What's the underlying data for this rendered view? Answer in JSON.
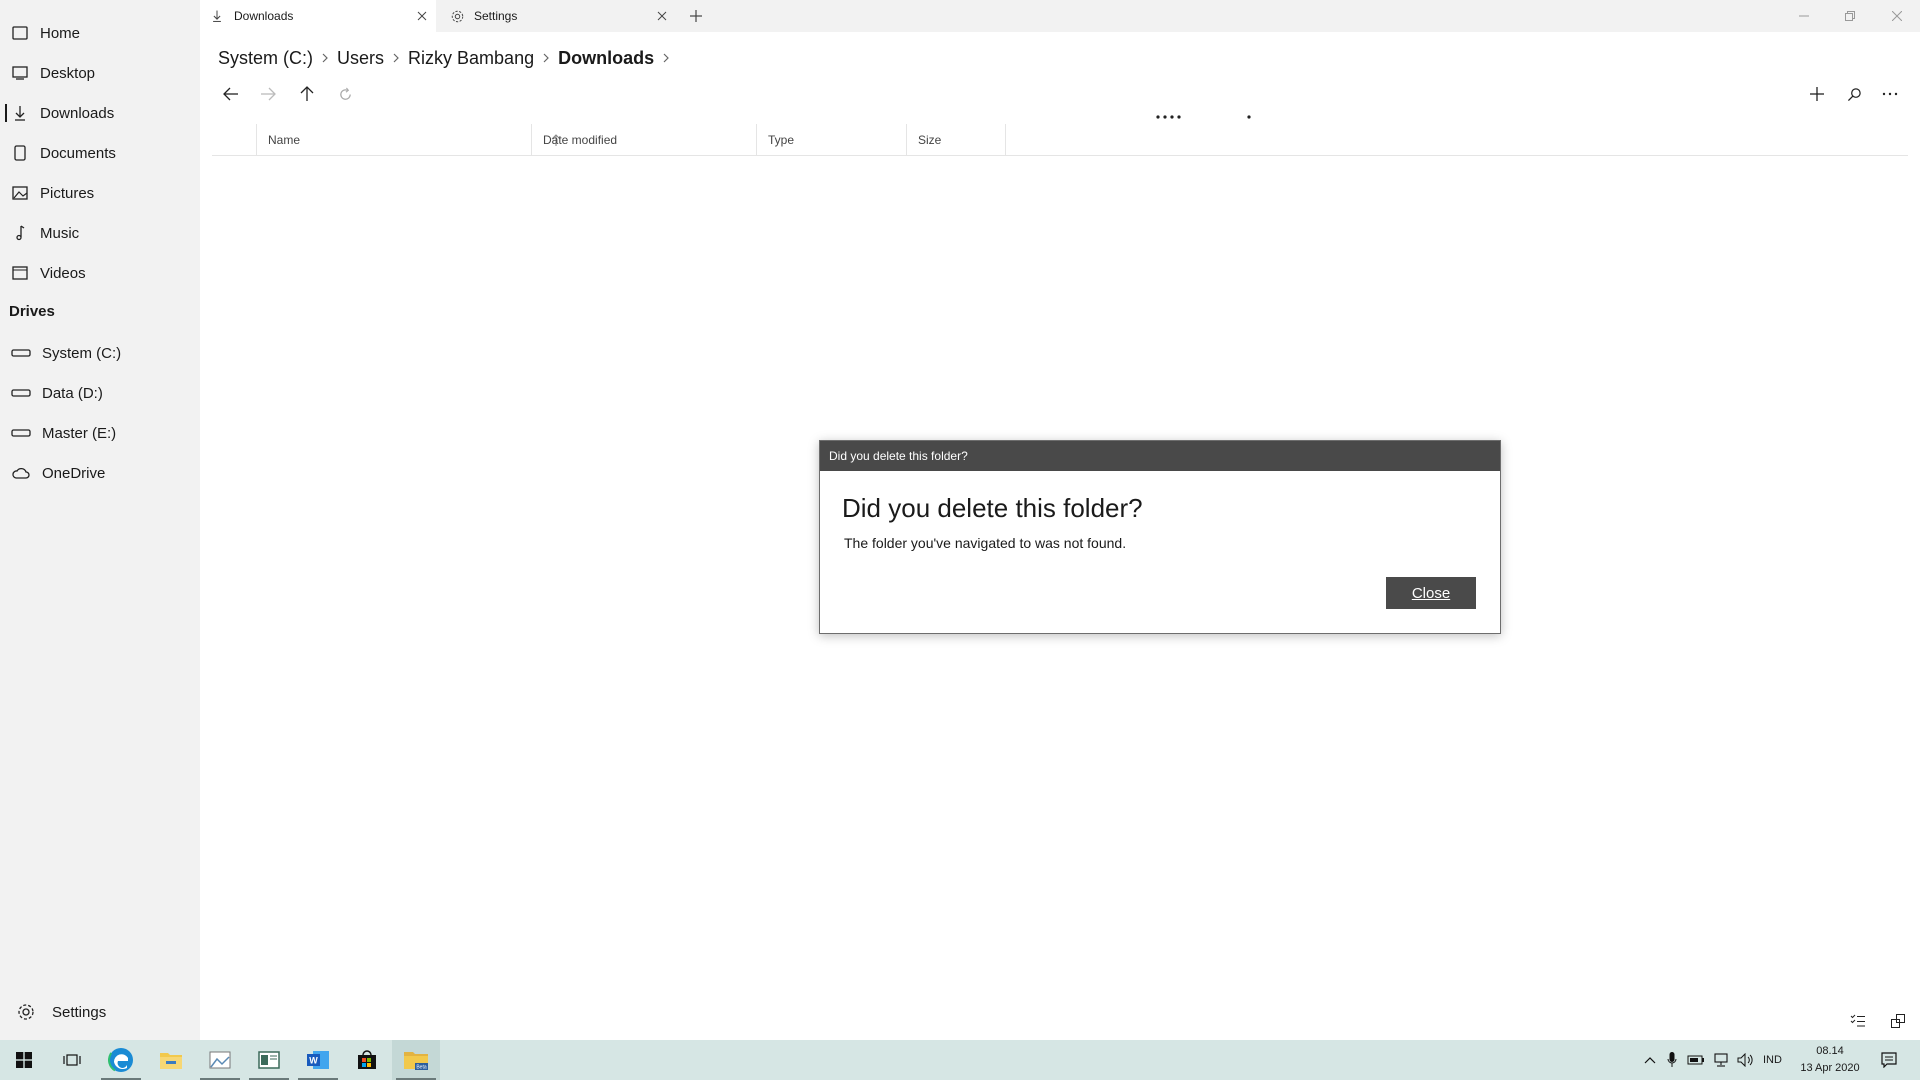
{
  "sidebar": {
    "items": [
      {
        "label": "Home",
        "icon": "home-icon"
      },
      {
        "label": "Desktop",
        "icon": "desktop-icon"
      },
      {
        "label": "Downloads",
        "icon": "download-icon"
      },
      {
        "label": "Documents",
        "icon": "document-icon"
      },
      {
        "label": "Pictures",
        "icon": "picture-icon"
      },
      {
        "label": "Music",
        "icon": "music-icon"
      },
      {
        "label": "Videos",
        "icon": "video-icon"
      }
    ],
    "drives_header": "Drives",
    "drives": [
      {
        "label": "System (C:)",
        "icon": "drive-icon"
      },
      {
        "label": "Data (D:)",
        "icon": "drive-icon"
      },
      {
        "label": "Master (E:)",
        "icon": "drive-icon"
      },
      {
        "label": "OneDrive",
        "icon": "cloud-icon"
      }
    ],
    "settings_label": "Settings"
  },
  "tabs": [
    {
      "label": "Downloads",
      "icon": "download-icon",
      "active": true
    },
    {
      "label": "Settings",
      "icon": "gear-icon",
      "active": false
    }
  ],
  "breadcrumb": {
    "items": [
      "System (C:)",
      "Users",
      "Rizky Bambang",
      "Downloads"
    ]
  },
  "columns": {
    "name": "Name",
    "date_modified": "Date modified",
    "type": "Type",
    "size": "Size",
    "sort": "ascending"
  },
  "dialog": {
    "title_bar": "Did you delete this folder?",
    "heading": "Did you delete this folder?",
    "message": "The folder you've navigated to was not found.",
    "close_label": "Close"
  },
  "taskbar": {
    "apps": [
      "start-icon",
      "task-view-icon",
      "edge-icon",
      "file-explorer-icon",
      "photos-icon",
      "app-icon",
      "word-icon",
      "store-icon",
      "files-beta-icon"
    ],
    "language": "IND",
    "time": "08.14",
    "date": "13 Apr 2020"
  },
  "colors": {
    "accent_dialog_title": "#494949",
    "taskbar": "#d6e6e4",
    "sidebar": "#f2f2f2"
  }
}
